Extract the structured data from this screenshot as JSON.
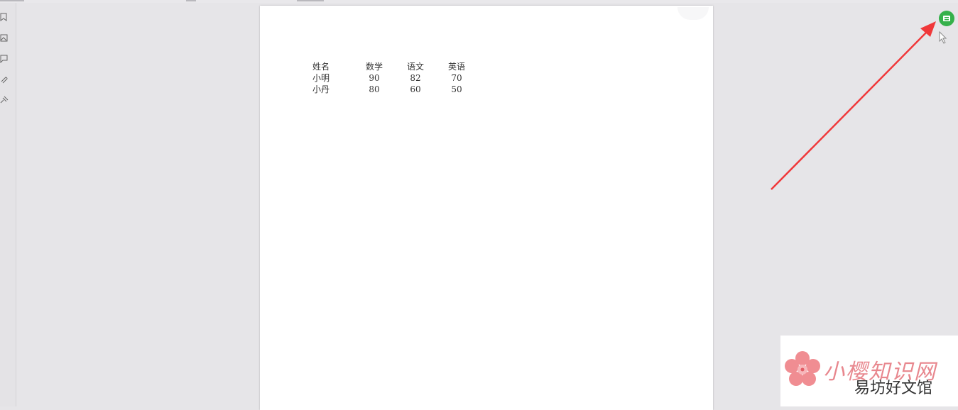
{
  "document": {
    "table": {
      "headers": [
        "姓名",
        "数学",
        "语文",
        "英语"
      ],
      "rows": [
        [
          "小明",
          "90",
          "82",
          "70"
        ],
        [
          "小丹",
          "80",
          "60",
          "50"
        ]
      ]
    }
  },
  "sidebar": {
    "icons": [
      "bookmark-icon",
      "image-icon",
      "comment-icon",
      "attachment-icon",
      "signature-icon"
    ]
  },
  "toolbar": {
    "export_icon": "export-excel-icon"
  },
  "annotation": {
    "arrow_color": "#f0383a"
  },
  "watermark": {
    "title": "小樱知识网",
    "subtitle": "易坊好文馆"
  }
}
